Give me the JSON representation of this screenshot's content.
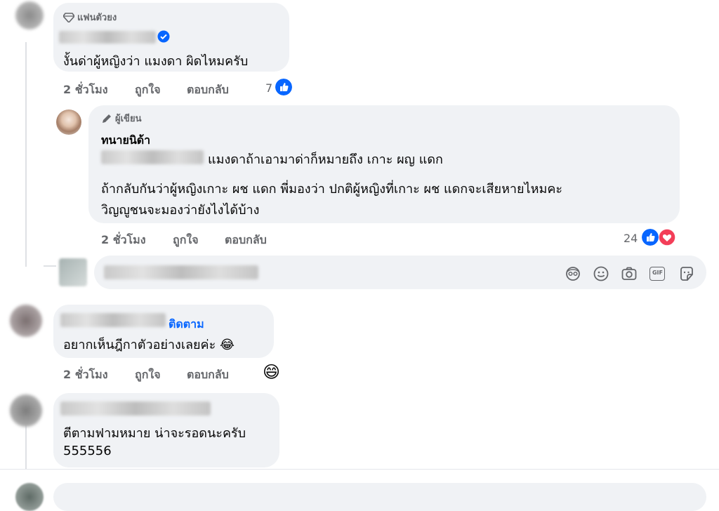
{
  "comment1": {
    "badge": "แฟนตัวยง",
    "text": "งั้นด่าผู้หญิงว่า แมงดา ผิดไหมครับ",
    "time": "2 ชั่วโมง",
    "like": "ถูกใจ",
    "reply": "ตอบกลับ",
    "reaction_count": "7"
  },
  "comment2": {
    "badge": "ผู้เขียน",
    "author": "ทนายนิด้า",
    "line1_suffix": "แมงดาถ้าเอามาด่าก็หมายถึง เกาะ ผญ แดก",
    "line2": "ถ้ากลับกันว่าผู้หญิงเกาะ ผช แดก พี่มองว่า ปกติผู้หญิงที่เกาะ ผช แดกจะเสียหายไหมคะ",
    "line3": "วิญญูชนจะมองว่ายังไงได้บ้าง",
    "time": "2 ชั่วโมง",
    "like": "ถูกใจ",
    "reply": "ตอบกลับ",
    "reaction_count": "24"
  },
  "reply_box": {
    "tools": [
      "avatar-sticker-icon",
      "emoji-icon",
      "camera-icon",
      "gif-icon",
      "sticker-icon"
    ],
    "gif_label": "GIF"
  },
  "comment3": {
    "follow": "ติดตาม",
    "text": "อยากเห็นฎีกาตัวอย่างเลยค่ะ 😂",
    "time": "2 ชั่วโมง",
    "like": "ถูกใจ",
    "reply": "ตอบกลับ",
    "reaction_emoji": "😄"
  },
  "comment4": {
    "text1": "ตีตามฟามหมาย น่าจะรอดนะครับ",
    "text2": "555556"
  },
  "colors": {
    "bubble": "#f0f2f5",
    "link": "#0866ff",
    "meta": "#65676b",
    "love": "#f33e58"
  }
}
